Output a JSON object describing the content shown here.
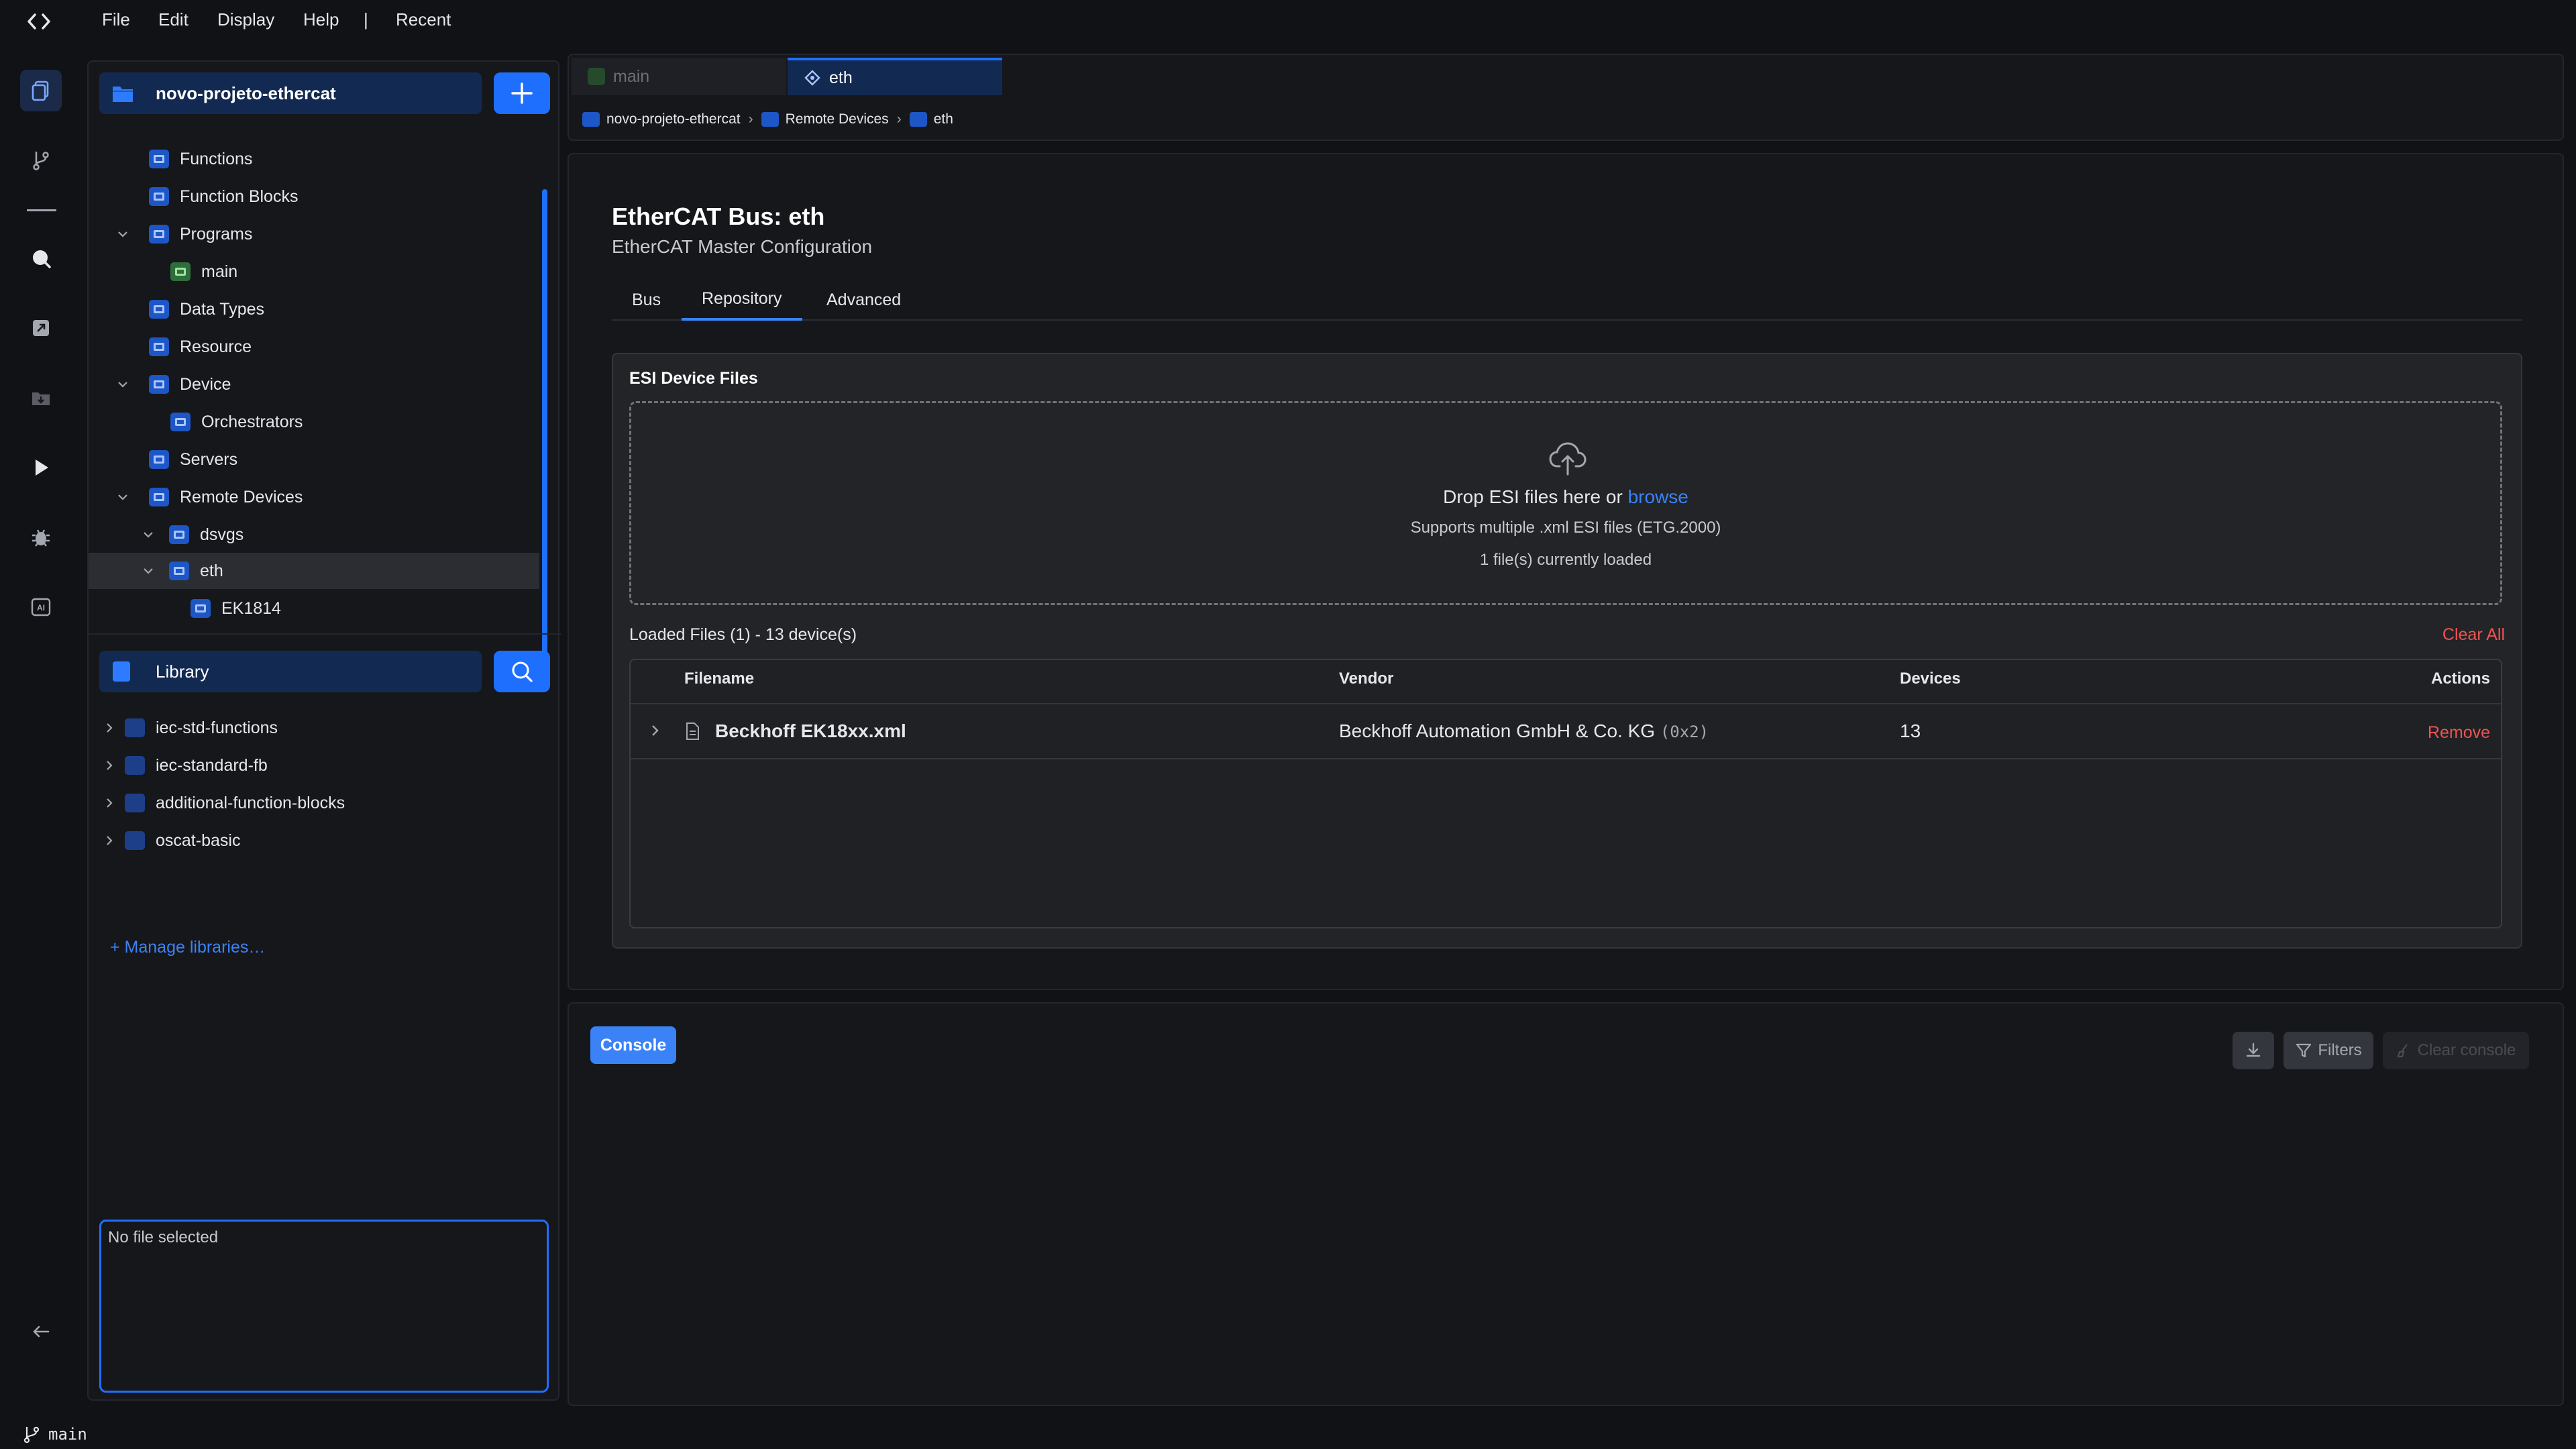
{
  "menu": {
    "items": [
      "File",
      "Edit",
      "Display",
      "Help"
    ],
    "separator": "|",
    "recent": "Recent"
  },
  "activity_bar": {
    "icons": [
      "files-icon",
      "git-branch-icon",
      "search-icon",
      "resize-icon",
      "download-folder-icon",
      "play-icon",
      "bug-icon",
      "ai-icon",
      "arrow-left-icon"
    ]
  },
  "explorer": {
    "project_name": "novo-projeto-ethercat",
    "tree": [
      {
        "label": "Functions"
      },
      {
        "label": "Function Blocks"
      },
      {
        "label": "Programs"
      },
      {
        "label": "main"
      },
      {
        "label": "Data Types"
      },
      {
        "label": "Resource"
      },
      {
        "label": "Device"
      },
      {
        "label": "Orchestrators"
      },
      {
        "label": "Servers"
      },
      {
        "label": "Remote Devices"
      },
      {
        "label": "dsvgs"
      },
      {
        "label": "eth"
      },
      {
        "label": "EK1814"
      }
    ],
    "library_title": "Library",
    "libraries": [
      {
        "label": "iec-std-functions"
      },
      {
        "label": "iec-standard-fb"
      },
      {
        "label": "additional-function-blocks"
      },
      {
        "label": "oscat-basic"
      }
    ],
    "manage_libraries": "+ Manage libraries…",
    "info_text": "No file selected"
  },
  "tabs": {
    "items": [
      {
        "label": "main"
      },
      {
        "label": "eth"
      }
    ],
    "breadcrumb": [
      "novo-projeto-ethercat",
      "Remote Devices",
      "eth"
    ]
  },
  "editor": {
    "title": "EtherCAT Bus: eth",
    "subtitle": "EtherCAT Master Configuration",
    "tabs": [
      "Bus",
      "Repository",
      "Advanced"
    ],
    "active_tab": "Repository",
    "esi": {
      "section_title": "ESI Device Files",
      "drop_text": "Drop ESI files here or ",
      "browse_text": "browse",
      "supports_text": "Supports multiple .xml ESI files (ETG.2000)",
      "loaded_count_text": "1 file(s) currently loaded",
      "loaded_summary": "Loaded Files (1) - 13 device(s)",
      "clear_all": "Clear All",
      "columns": {
        "filename": "Filename",
        "vendor": "Vendor",
        "devices": "Devices",
        "actions": "Actions"
      },
      "rows": [
        {
          "filename": "Beckhoff EK18xx.xml",
          "vendor": "Beckhoff Automation GmbH & Co. KG",
          "vendor_id": "(0x2)",
          "devices": "13",
          "action": "Remove"
        }
      ]
    }
  },
  "console": {
    "title": "Console",
    "filters": "Filters",
    "clear": "Clear console"
  },
  "status": {
    "branch": "main"
  },
  "colors": {
    "accent": "#1f6fff",
    "danger": "#ef5350",
    "panel": "#16171b",
    "background": "#111216"
  }
}
